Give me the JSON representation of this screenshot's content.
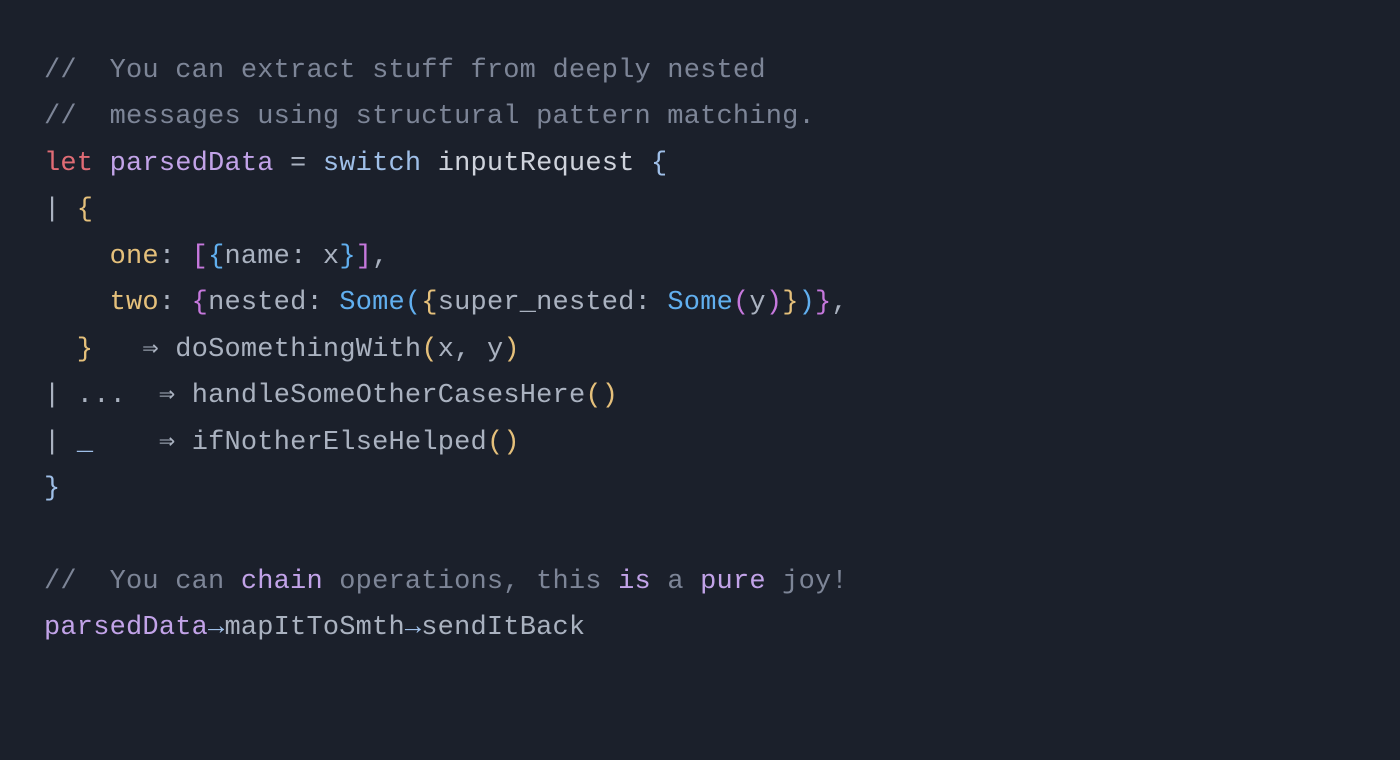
{
  "code": {
    "l1_a": "// ",
    "l1_b": " You can extract stuff from deeply nested",
    "l2_a": "// ",
    "l2_b": " messages using structural pattern matching.",
    "let": "let",
    "parsedData": "parsedData",
    "eq": " = ",
    "switch": "switch",
    "sp": " ",
    "inputRequest": "inputRequest",
    "bo": " {",
    "pipe": "|",
    "bo2": " {",
    "indent4": "    ",
    "one": "one",
    "colon": ": ",
    "lbracket": "[",
    "lbrace_p": "{",
    "name": "name",
    "colon2": ": ",
    "x": "x",
    "rbrace_p": "}",
    "rbracket": "]",
    "comma": ",",
    "two": "two",
    "nested": "nested",
    "Some": "Some",
    "lparen_b": "(",
    "super_nested": "super_nested",
    "y": "y",
    "rparen_b": ")",
    "rparen_y": ")",
    "rbrace_close": "  }",
    "arrow_sp": "   ⇒ ",
    "doSomethingWith": "doSomethingWith",
    "args_xy_open": "(",
    "args_x": "x",
    "args_sep": ", ",
    "args_y": "y",
    "args_xy_close": ")",
    "dots": " ...  ⇒ ",
    "handleSomeOtherCasesHere": "handleSomeOtherCasesHere",
    "empty_call": "()",
    "wild_line": " ",
    "wild": "_",
    "wild_arrow": "    ⇒ ",
    "ifNotherElseHelped": "ifNotherElseHelped",
    "bc": "}",
    "c2_a": "// ",
    "c2_b": " You can ",
    "chain": "chain",
    "c2_c": " operations, this ",
    "is": "is",
    "c2_d": " a ",
    "pure": "pure",
    "c2_e": " joy!",
    "mapItToSmth": "mapItToSmth",
    "sendItBack": "sendItBack",
    "arr": "→"
  }
}
